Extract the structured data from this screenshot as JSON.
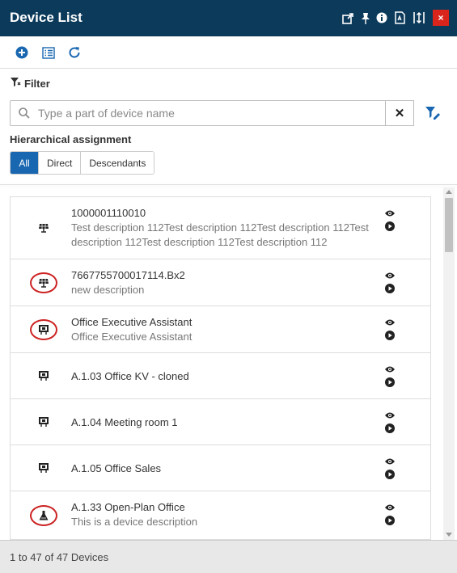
{
  "header": {
    "title": "Device List",
    "icons": [
      "external-link-icon",
      "pin-icon",
      "info-icon",
      "pdf-icon",
      "resize-icon",
      "close-icon"
    ],
    "close_label": "×",
    "bg_color": "#0b3a5b",
    "close_color": "#d9251c"
  },
  "toolbar": {
    "icons": [
      "add-icon",
      "list-icon",
      "refresh-icon"
    ]
  },
  "filter": {
    "title": "Filter",
    "search_placeholder": "Type a part of device name",
    "search_value": "",
    "clear_label": "✕"
  },
  "hierarchical": {
    "label": "Hierarchical assignment",
    "options": [
      "All",
      "Direct",
      "Descendants"
    ],
    "selected": "All",
    "accent_color": "#1967b1"
  },
  "devices": [
    {
      "name": "1000001110010",
      "description": "Test description 112Test description 112Test description 112Test description 112Test description 112Test description 112",
      "icon": "solar-panel-icon",
      "circled": false
    },
    {
      "name": "7667755700017114.Bx2",
      "description": "new description",
      "icon": "solar-panel-icon",
      "circled": true
    },
    {
      "name": "Office Executive Assistant",
      "description": "Office Executive Assistant",
      "icon": "room-icon",
      "circled": true
    },
    {
      "name": "A.1.03 Office KV - cloned",
      "description": "",
      "icon": "room-icon",
      "circled": false
    },
    {
      "name": "A.1.04 Meeting room 1",
      "description": "",
      "icon": "room-icon",
      "circled": false
    },
    {
      "name": "A.1.05 Office Sales",
      "description": "",
      "icon": "room-icon",
      "circled": false
    },
    {
      "name": "A.1.33 Open-Plan Office",
      "description": "This is a device description",
      "icon": "flask-icon",
      "circled": true
    }
  ],
  "footer": {
    "status": "1 to 47 of 47 Devices"
  }
}
